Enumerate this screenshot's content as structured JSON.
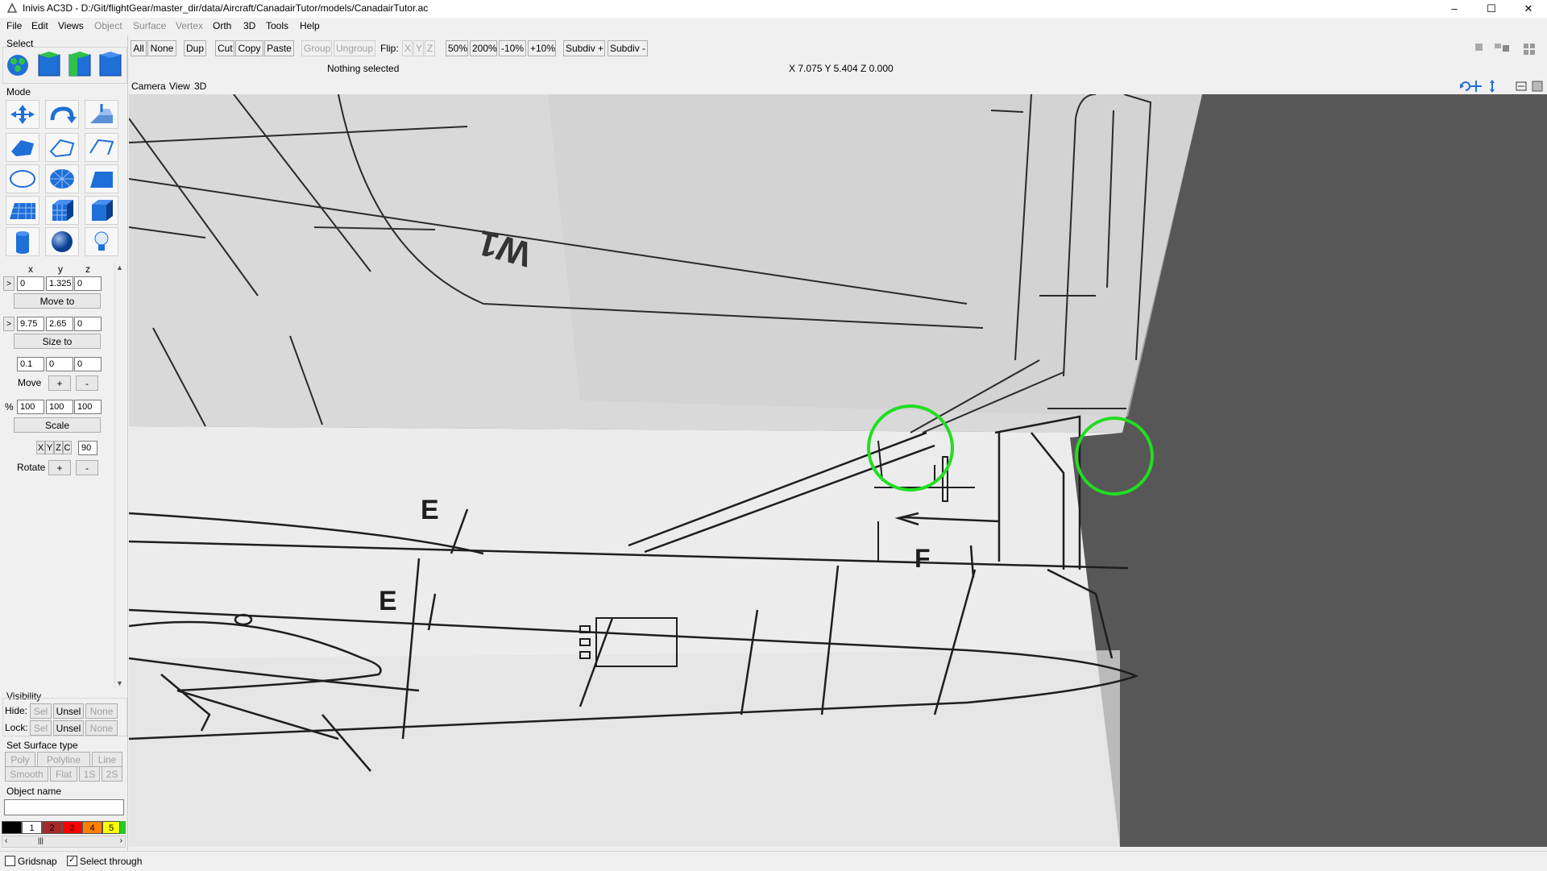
{
  "window": {
    "title": "Inivis AC3D - D:/Git/flightGear/master_dir/data/Aircraft/CanadairTutor/models/CanadairTutor.ac",
    "minimize": "–",
    "maximize": "☐",
    "close": "✕"
  },
  "menu": {
    "file": "File",
    "edit": "Edit",
    "views": "Views",
    "object": "Object",
    "surface": "Surface",
    "vertex": "Vertex",
    "orth": "Orth",
    "three_d": "3D",
    "tools": "Tools",
    "help": "Help"
  },
  "toolbar": {
    "all": "All",
    "none": "None",
    "dup": "Dup",
    "cut": "Cut",
    "copy": "Copy",
    "paste": "Paste",
    "group": "Group",
    "ungroup": "Ungroup",
    "flip_label": "Flip:",
    "flip_x": "X",
    "flip_y": "Y",
    "flip_z": "Z",
    "zoom50": "50%",
    "zoom200": "200%",
    "minus10": "-10%",
    "plus10": "+10%",
    "subdiv_plus": "Subdiv +",
    "subdiv_minus": "Subdiv -",
    "status": "Nothing selected",
    "coords": "X 7.075 Y 5.404 Z 0.000"
  },
  "left": {
    "select_label": "Select",
    "mode_label": "Mode",
    "axis_x": "x",
    "axis_y": "y",
    "axis_z": "z",
    "pos": [
      "0",
      "1.325",
      "0"
    ],
    "move_to": "Move to",
    "size": [
      "9.75",
      "2.65",
      "0"
    ],
    "size_to": "Size to",
    "move_vals": [
      "0.1",
      "0",
      "0"
    ],
    "move_label": "Move",
    "plus": "+",
    "minus": "-",
    "pct_label": "%",
    "scale_vals": [
      "100",
      "100",
      "100"
    ],
    "scale": "Scale",
    "rot_x": "X",
    "rot_y": "Y",
    "rot_z": "Z",
    "rot_c": "C",
    "rot_angle": "90",
    "rotate_label": "Rotate",
    "arrow": ">",
    "visibility_label": "Visibility",
    "hide_label": "Hide:",
    "lock_label": "Lock:",
    "sel": "Sel",
    "unsel": "Unsel",
    "none": "None",
    "surface_type_label": "Set Surface type",
    "poly": "Poly",
    "polyline": "Polyline",
    "line": "Line",
    "smooth": "Smooth",
    "flat": "Flat",
    "one_s": "1S",
    "two_s": "2S",
    "object_name_label": "Object name",
    "object_name_value": "",
    "palette": [
      {
        "label": "",
        "color": "#000000",
        "text": "#ffffff"
      },
      {
        "label": "1",
        "color": "#ffffff",
        "text": "#000000"
      },
      {
        "label": "2",
        "color": "#a52a2a",
        "text": "#000000"
      },
      {
        "label": "3",
        "color": "#ff0000",
        "text": "#000000"
      },
      {
        "label": "4",
        "color": "#ff8000",
        "text": "#000000"
      },
      {
        "label": "5",
        "color": "#ffff00",
        "text": "#000000"
      }
    ]
  },
  "view": {
    "camera": "Camera",
    "view": "View",
    "mode": "3D"
  },
  "blueprint": {
    "labels": [
      "E",
      "E",
      "F",
      "W1"
    ],
    "highlight_color": "#22dd22"
  },
  "status": {
    "gridsnap": "Gridsnap",
    "gridsnap_checked": false,
    "select_through": "Select through",
    "select_through_checked": true
  }
}
